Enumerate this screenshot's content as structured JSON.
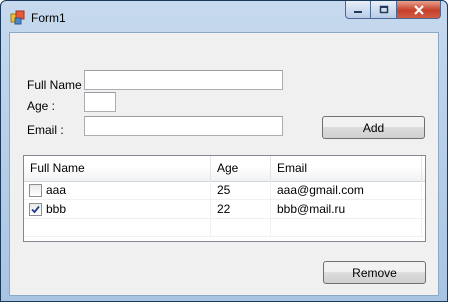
{
  "window": {
    "title": "Form1"
  },
  "form": {
    "fullname_label": "Full Name :",
    "fullname_value": "",
    "age_label": "Age :",
    "age_value": "",
    "email_label": "Email :",
    "email_value": "",
    "add_label": "Add",
    "remove_label": "Remove"
  },
  "list": {
    "columns": [
      "Full Name",
      "Age",
      "Email"
    ],
    "rows": [
      {
        "checked": false,
        "name": "aaa",
        "age": "25",
        "email": "aaa@gmail.com"
      },
      {
        "checked": true,
        "name": "bbb",
        "age": "22",
        "email": "bbb@mail.ru"
      }
    ]
  },
  "icons": {
    "app": "form-app-icon",
    "minimize": "minimize-icon",
    "maximize": "maximize-icon",
    "close": "close-icon"
  }
}
